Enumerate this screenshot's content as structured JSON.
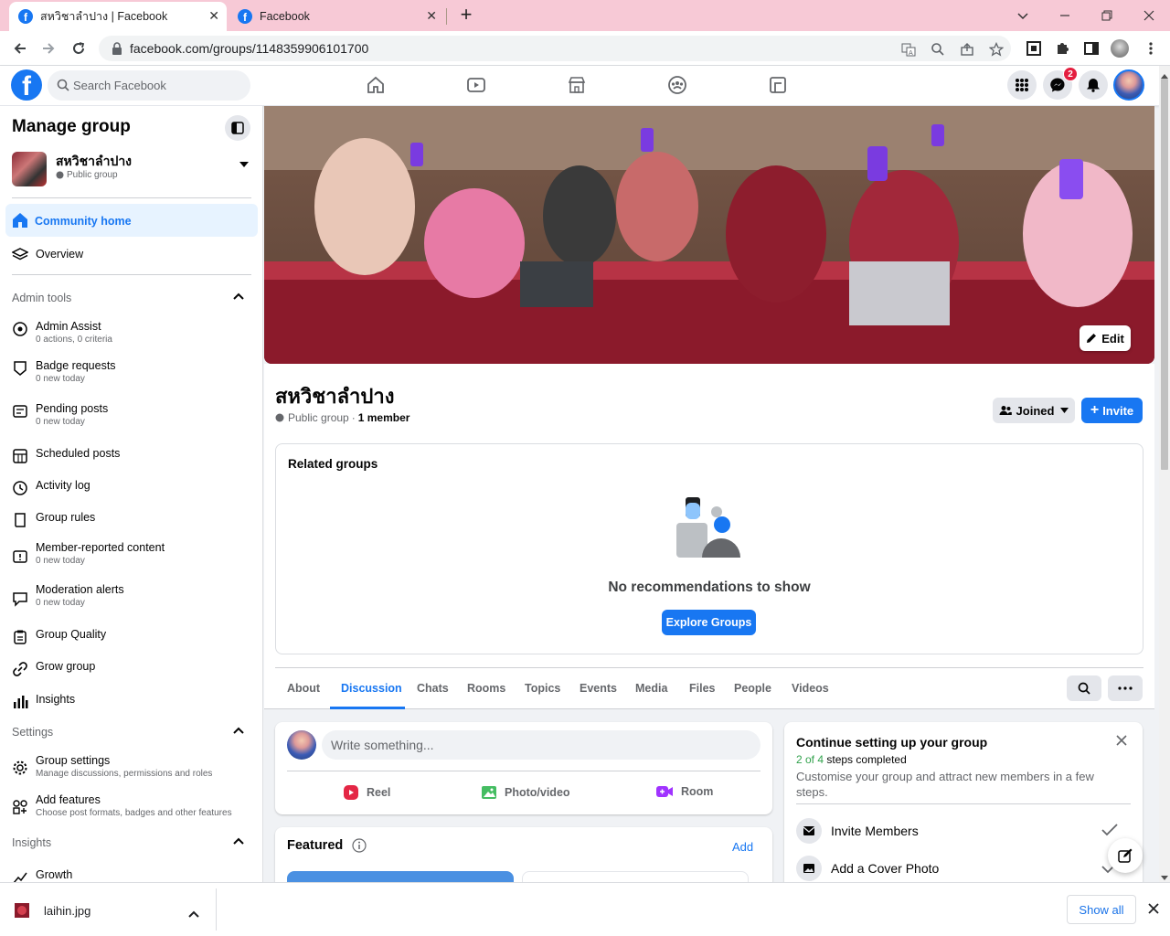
{
  "browser": {
    "tabs": [
      {
        "title": "สหวิชาลำปาง | Facebook",
        "active": true
      },
      {
        "title": "Facebook",
        "active": false
      }
    ],
    "url": "facebook.com/groups/1148359906101700"
  },
  "header": {
    "search_placeholder": "Search Facebook",
    "messenger_badge": "2"
  },
  "sidebar": {
    "title": "Manage group",
    "group_name": "สหวิชาลำปาง",
    "group_privacy": "Public group",
    "nav": [
      {
        "label": "Community home",
        "active": true
      },
      {
        "label": "Overview"
      }
    ],
    "admin_tools_title": "Admin tools",
    "admin_tools": [
      {
        "label": "Admin Assist",
        "sub": "0 actions, 0 criteria"
      },
      {
        "label": "Badge requests",
        "sub": "0 new today"
      },
      {
        "label": "Pending posts",
        "sub": "0 new today"
      },
      {
        "label": "Scheduled posts",
        "sub": ""
      },
      {
        "label": "Activity log",
        "sub": ""
      },
      {
        "label": "Group rules",
        "sub": ""
      },
      {
        "label": "Member-reported content",
        "sub": "0 new today"
      },
      {
        "label": "Moderation alerts",
        "sub": "0 new today"
      },
      {
        "label": "Group Quality",
        "sub": ""
      },
      {
        "label": "Grow group",
        "sub": ""
      },
      {
        "label": "Insights",
        "sub": ""
      }
    ],
    "settings_title": "Settings",
    "settings": [
      {
        "label": "Group settings",
        "sub": "Manage discussions, permissions and roles"
      },
      {
        "label": "Add features",
        "sub": "Choose post formats, badges and other features"
      }
    ],
    "insights_title": "Insights",
    "insights": [
      {
        "label": "Growth"
      }
    ]
  },
  "group": {
    "edit_label": "Edit",
    "name": "สหวิชาลำปาง",
    "privacy": "Public group",
    "separator": "·",
    "members": "1 member",
    "joined_label": "Joined",
    "invite_label": "Invite",
    "related_title": "Related groups",
    "no_recs": "No recommendations to show",
    "explore_label": "Explore Groups",
    "tabs": [
      "About",
      "Discussion",
      "Chats",
      "Rooms",
      "Topics",
      "Events",
      "Media",
      "Files",
      "People",
      "Videos"
    ],
    "active_tab": "Discussion"
  },
  "composer": {
    "placeholder": "Write something...",
    "actions": [
      "Reel",
      "Photo/video",
      "Room"
    ]
  },
  "featured": {
    "title": "Featured",
    "add_label": "Add"
  },
  "setup": {
    "title": "Continue setting up your group",
    "progress_count": "2 of 4",
    "progress_suffix": "steps completed",
    "description": "Customise your group and attract new members in a few steps.",
    "steps": [
      {
        "label": "Invite Members",
        "done": true
      },
      {
        "label": "Add a Cover Photo",
        "done": false
      }
    ]
  },
  "download": {
    "filename": "laihin.jpg",
    "show_all": "Show all"
  }
}
